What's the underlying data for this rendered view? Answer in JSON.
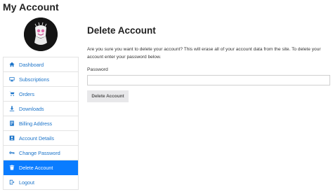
{
  "page": {
    "title": "My Account"
  },
  "sidebar": {
    "items": [
      {
        "label": "Dashboard",
        "icon": "home-icon",
        "active": false
      },
      {
        "label": "Subscriptions",
        "icon": "monitor-icon",
        "active": false
      },
      {
        "label": "Orders",
        "icon": "cart-icon",
        "active": false
      },
      {
        "label": "Downloads",
        "icon": "download-icon",
        "active": false
      },
      {
        "label": "Billing Address",
        "icon": "credit-card-icon",
        "active": false
      },
      {
        "label": "Account Details",
        "icon": "id-card-icon",
        "active": false
      },
      {
        "label": "Change Password",
        "icon": "key-icon",
        "active": false
      },
      {
        "label": "Delete Account",
        "icon": "trash-icon",
        "active": true
      },
      {
        "label": "Logout",
        "icon": "logout-icon",
        "active": false
      }
    ]
  },
  "main": {
    "title": "Delete Account",
    "description": "Are you sure you want to delete your account? This will erase all of your account data from the site. To delete your account enter your password below.",
    "password_label": "Password",
    "password_value": "",
    "password_placeholder": "",
    "delete_button": "Delete Account"
  },
  "colors": {
    "link": "#1a73c9",
    "active_bg": "#0a7cff",
    "button_bg": "#e8e8ea"
  }
}
